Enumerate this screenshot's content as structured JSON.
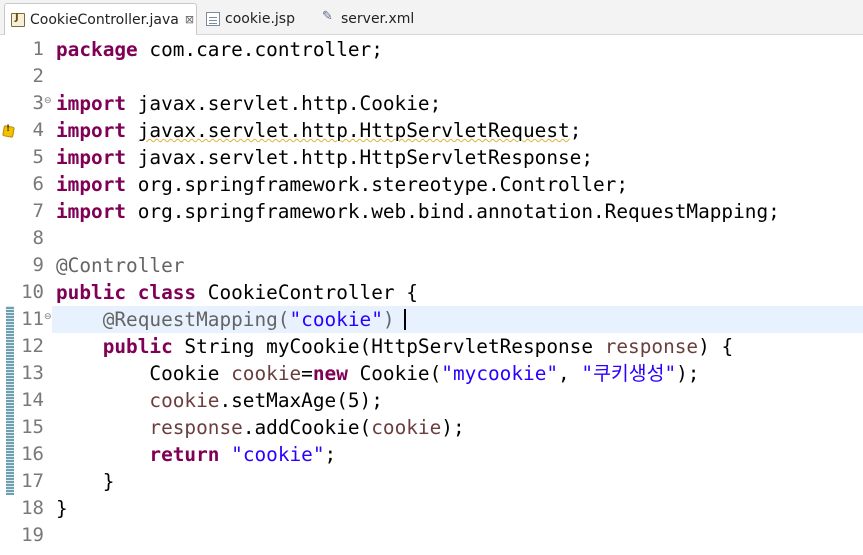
{
  "tabs": [
    {
      "label": "CookieController.java",
      "icon": "java-file-icon",
      "active": true,
      "close": "⊠"
    },
    {
      "label": "cookie.jsp",
      "icon": "jsp-file-icon",
      "active": false
    },
    {
      "label": "server.xml",
      "icon": "xml-file-icon",
      "active": false
    }
  ],
  "colors": {
    "keyword": "#7f0055",
    "string": "#2a00ff",
    "variable": "#6a3e3e",
    "annotation": "#646464",
    "current_line": "#e8f2fe"
  },
  "editor": {
    "line_numbers": [
      "1",
      "2",
      "3",
      "4",
      "5",
      "6",
      "7",
      "8",
      "9",
      "10",
      "11",
      "12",
      "13",
      "14",
      "15",
      "16",
      "17",
      "18",
      "19"
    ],
    "fold_markers": [
      "⊖",
      "⊖"
    ],
    "lines": [
      [
        {
          "t": "package",
          "c": "kw"
        },
        {
          "t": " com.care.controller;",
          "c": "plain"
        }
      ],
      [],
      [
        {
          "t": "import",
          "c": "kw"
        },
        {
          "t": " javax.servlet.http.Cookie;",
          "c": "plain"
        }
      ],
      [
        {
          "t": "import",
          "c": "kw"
        },
        {
          "t": " ",
          "c": "plain"
        },
        {
          "t": "javax.servlet.http.HttpServletRequest",
          "c": "plain squig"
        },
        {
          "t": ";",
          "c": "plain"
        }
      ],
      [
        {
          "t": "import",
          "c": "kw"
        },
        {
          "t": " javax.servlet.http.HttpServletResponse;",
          "c": "plain"
        }
      ],
      [
        {
          "t": "import",
          "c": "kw"
        },
        {
          "t": " org.springframework.stereotype.Controller;",
          "c": "plain"
        }
      ],
      [
        {
          "t": "import",
          "c": "kw"
        },
        {
          "t": " org.springframework.web.bind.annotation.RequestMapping;",
          "c": "plain"
        }
      ],
      [],
      [
        {
          "t": "@Controller",
          "c": "ann"
        }
      ],
      [
        {
          "t": "public",
          "c": "kw"
        },
        {
          "t": " ",
          "c": "plain"
        },
        {
          "t": "class",
          "c": "kw"
        },
        {
          "t": " CookieController {",
          "c": "plain"
        }
      ],
      [
        {
          "t": "    @RequestMapping(",
          "c": "ann"
        },
        {
          "t": "\"cookie\"",
          "c": "str"
        },
        {
          "t": ")",
          "c": "ann"
        }
      ],
      [
        {
          "t": "    ",
          "c": "plain"
        },
        {
          "t": "public",
          "c": "kw"
        },
        {
          "t": " String myCookie(HttpServletResponse ",
          "c": "plain"
        },
        {
          "t": "response",
          "c": "fld"
        },
        {
          "t": ") {",
          "c": "plain"
        }
      ],
      [
        {
          "t": "        Cookie ",
          "c": "plain"
        },
        {
          "t": "cookie",
          "c": "fld"
        },
        {
          "t": "=",
          "c": "plain"
        },
        {
          "t": "new",
          "c": "kw"
        },
        {
          "t": " Cookie(",
          "c": "plain"
        },
        {
          "t": "\"mycookie\"",
          "c": "str"
        },
        {
          "t": ", ",
          "c": "plain"
        },
        {
          "t": "\"쿠키생성\"",
          "c": "str"
        },
        {
          "t": ");",
          "c": "plain"
        }
      ],
      [
        {
          "t": "        ",
          "c": "plain"
        },
        {
          "t": "cookie",
          "c": "fld"
        },
        {
          "t": ".setMaxAge(5);",
          "c": "plain"
        }
      ],
      [
        {
          "t": "        ",
          "c": "plain"
        },
        {
          "t": "response",
          "c": "fld"
        },
        {
          "t": ".addCookie(",
          "c": "plain"
        },
        {
          "t": "cookie",
          "c": "fld"
        },
        {
          "t": ");",
          "c": "plain"
        }
      ],
      [
        {
          "t": "        ",
          "c": "plain"
        },
        {
          "t": "return",
          "c": "kw"
        },
        {
          "t": " ",
          "c": "plain"
        },
        {
          "t": "\"cookie\"",
          "c": "str"
        },
        {
          "t": ";",
          "c": "plain"
        }
      ],
      [
        {
          "t": "    }",
          "c": "plain"
        }
      ],
      [
        {
          "t": "}",
          "c": "plain"
        }
      ],
      []
    ]
  }
}
